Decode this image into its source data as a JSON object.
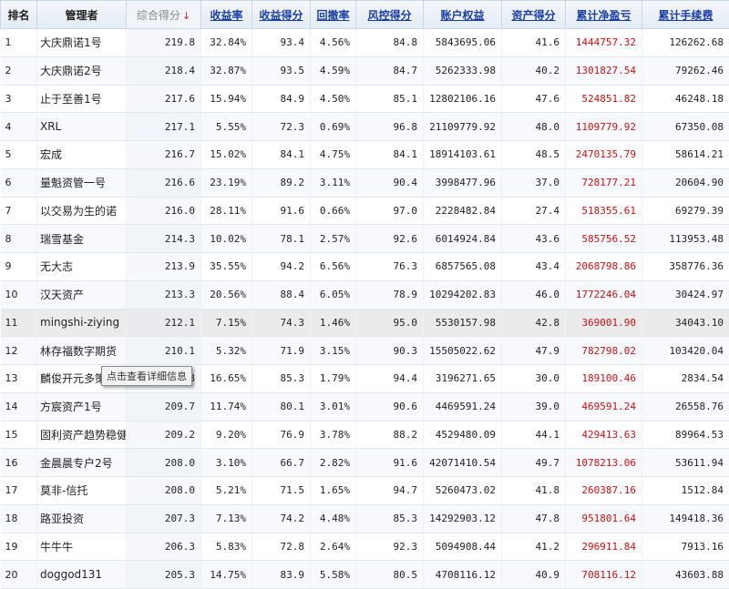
{
  "headers": {
    "rank": "排名",
    "manager": "管理者",
    "total_score": "综合得分",
    "sort_arrow": "↓",
    "return_rate": "收益率",
    "return_score": "收益得分",
    "drawdown": "回撤率",
    "risk_score": "风控得分",
    "equity": "账户权益",
    "asset_score": "资产得分",
    "cum_pnl": "累计净盈亏",
    "cum_fee": "累计手续费"
  },
  "tooltip": "点击查看详细信息",
  "colors": {
    "link": "#1a3ea8",
    "pnl": "#d01010",
    "sort_arrow": "#e02020"
  },
  "rows": [
    {
      "rank": "1",
      "name": "大庆鼎诺1号",
      "score": "219.8",
      "ret": "32.84%",
      "ret_score": "93.4",
      "dd": "4.56%",
      "risk": "84.8",
      "equity": "5843695.06",
      "asset": "41.6",
      "pnl": "1444757.32",
      "fee": "126262.68"
    },
    {
      "rank": "2",
      "name": "大庆鼎诺2号",
      "score": "218.4",
      "ret": "32.87%",
      "ret_score": "93.5",
      "dd": "4.59%",
      "risk": "84.7",
      "equity": "5262333.98",
      "asset": "40.2",
      "pnl": "1301827.54",
      "fee": "79262.46"
    },
    {
      "rank": "3",
      "name": "止于至善1号",
      "score": "217.6",
      "ret": "15.94%",
      "ret_score": "84.9",
      "dd": "4.50%",
      "risk": "85.1",
      "equity": "12802106.16",
      "asset": "47.6",
      "pnl": "524851.82",
      "fee": "46248.18"
    },
    {
      "rank": "4",
      "name": "XRL",
      "score": "217.1",
      "ret": "5.55%",
      "ret_score": "72.3",
      "dd": "0.69%",
      "risk": "96.8",
      "equity": "21109779.92",
      "asset": "48.0",
      "pnl": "1109779.92",
      "fee": "67350.08"
    },
    {
      "rank": "5",
      "name": "宏成",
      "score": "216.7",
      "ret": "15.02%",
      "ret_score": "84.1",
      "dd": "4.75%",
      "risk": "84.1",
      "equity": "18914103.61",
      "asset": "48.5",
      "pnl": "2470135.79",
      "fee": "58614.21"
    },
    {
      "rank": "6",
      "name": "量魁资管一号",
      "score": "216.6",
      "ret": "23.19%",
      "ret_score": "89.2",
      "dd": "3.11%",
      "risk": "90.4",
      "equity": "3998477.96",
      "asset": "37.0",
      "pnl": "728177.21",
      "fee": "20604.90"
    },
    {
      "rank": "7",
      "name": "以交易为生的诺",
      "score": "216.0",
      "ret": "28.11%",
      "ret_score": "91.6",
      "dd": "0.66%",
      "risk": "97.0",
      "equity": "2228482.84",
      "asset": "27.4",
      "pnl": "518355.61",
      "fee": "69279.39"
    },
    {
      "rank": "8",
      "name": "瑞雪基金",
      "score": "214.3",
      "ret": "10.02%",
      "ret_score": "78.1",
      "dd": "2.57%",
      "risk": "92.6",
      "equity": "6014924.84",
      "asset": "43.6",
      "pnl": "585756.52",
      "fee": "113953.48"
    },
    {
      "rank": "9",
      "name": "无大志",
      "score": "213.9",
      "ret": "35.55%",
      "ret_score": "94.2",
      "dd": "6.56%",
      "risk": "76.3",
      "equity": "6857565.08",
      "asset": "43.4",
      "pnl": "2068798.86",
      "fee": "358776.36"
    },
    {
      "rank": "10",
      "name": "汉天资产",
      "score": "213.3",
      "ret": "20.56%",
      "ret_score": "88.4",
      "dd": "6.05%",
      "risk": "78.9",
      "equity": "10294202.83",
      "asset": "46.0",
      "pnl": "1772246.04",
      "fee": "30424.97"
    },
    {
      "rank": "11",
      "name": "mingshi-ziying",
      "score": "212.1",
      "ret": "7.15%",
      "ret_score": "74.3",
      "dd": "1.46%",
      "risk": "95.0",
      "equity": "5530157.98",
      "asset": "42.8",
      "pnl": "369001.90",
      "fee": "34043.10"
    },
    {
      "rank": "12",
      "name": "林存福数字期货",
      "score": "210.1",
      "ret": "5.32%",
      "ret_score": "71.9",
      "dd": "3.15%",
      "risk": "90.3",
      "equity": "15505022.62",
      "asset": "47.9",
      "pnl": "782798.02",
      "fee": "103420.04"
    },
    {
      "rank": "13",
      "name": "麟俊开元多策略",
      "score": "209.8",
      "ret": "16.65%",
      "ret_score": "85.3",
      "dd": "1.79%",
      "risk": "94.4",
      "equity": "3196271.65",
      "asset": "30.0",
      "pnl": "189100.46",
      "fee": "2834.54"
    },
    {
      "rank": "14",
      "name": "方宸资产1号",
      "score": "209.7",
      "ret": "11.74%",
      "ret_score": "80.1",
      "dd": "3.01%",
      "risk": "90.6",
      "equity": "4469591.24",
      "asset": "39.0",
      "pnl": "469591.24",
      "fee": "26558.76"
    },
    {
      "rank": "15",
      "name": "固利资产趋势稳健",
      "score": "209.2",
      "ret": "9.20%",
      "ret_score": "76.9",
      "dd": "3.78%",
      "risk": "88.2",
      "equity": "4529480.09",
      "asset": "44.1",
      "pnl": "429413.63",
      "fee": "89964.53"
    },
    {
      "rank": "16",
      "name": "金晨晨专户2号",
      "score": "208.0",
      "ret": "3.10%",
      "ret_score": "66.7",
      "dd": "2.82%",
      "risk": "91.6",
      "equity": "42071410.54",
      "asset": "49.7",
      "pnl": "1078213.06",
      "fee": "53611.94"
    },
    {
      "rank": "17",
      "name": "莫非-信托",
      "score": "208.0",
      "ret": "5.21%",
      "ret_score": "71.5",
      "dd": "1.65%",
      "risk": "94.7",
      "equity": "5260473.02",
      "asset": "41.8",
      "pnl": "260387.16",
      "fee": "1512.84"
    },
    {
      "rank": "18",
      "name": "路亚投资",
      "score": "207.3",
      "ret": "7.13%",
      "ret_score": "74.2",
      "dd": "4.48%",
      "risk": "85.3",
      "equity": "14292903.12",
      "asset": "47.8",
      "pnl": "951801.64",
      "fee": "149418.36"
    },
    {
      "rank": "19",
      "name": "牛牛牛",
      "score": "206.3",
      "ret": "5.83%",
      "ret_score": "72.8",
      "dd": "2.64%",
      "risk": "92.3",
      "equity": "5094908.44",
      "asset": "41.2",
      "pnl": "296911.84",
      "fee": "7913.16"
    },
    {
      "rank": "20",
      "name": "doggod131",
      "score": "205.3",
      "ret": "14.75%",
      "ret_score": "83.9",
      "dd": "5.58%",
      "risk": "80.5",
      "equity": "4708116.12",
      "asset": "40.9",
      "pnl": "708116.12",
      "fee": "43603.88"
    }
  ]
}
